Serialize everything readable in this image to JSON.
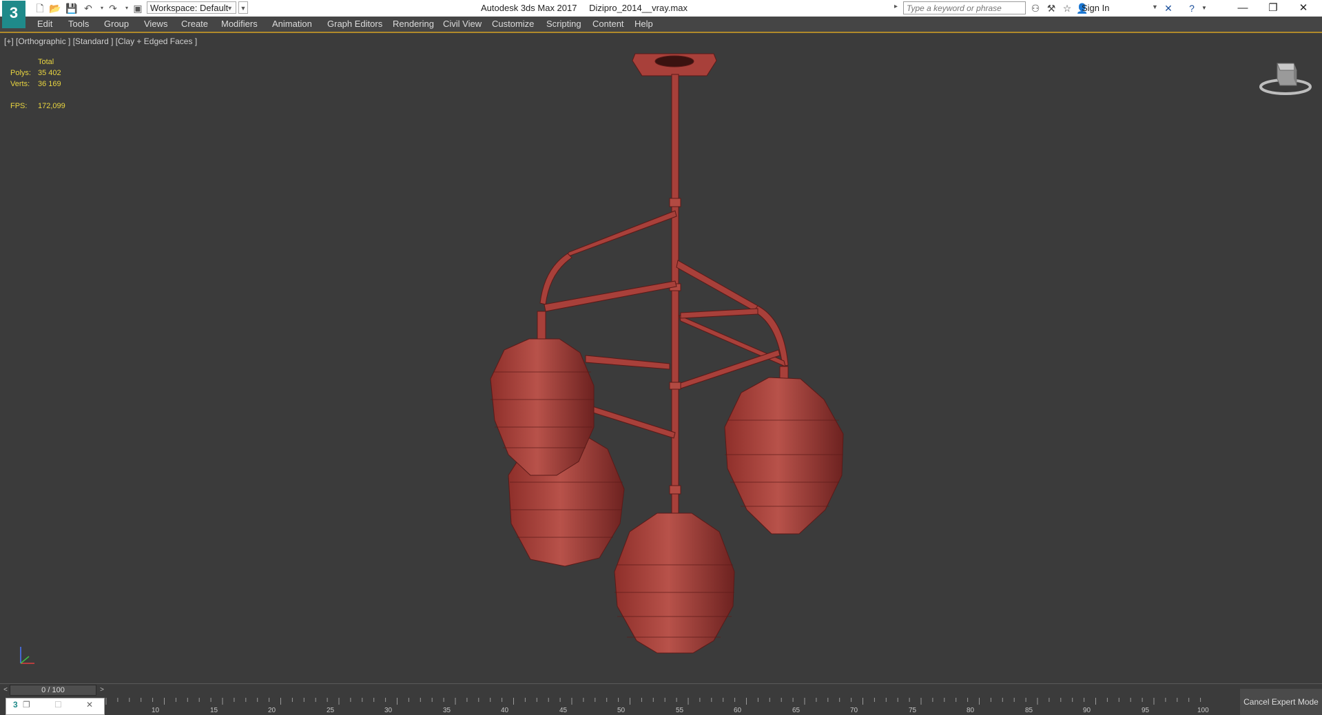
{
  "titlebar": {
    "logo_text": "3",
    "workspace_label": "Workspace: Default",
    "app_name": "Autodesk 3ds Max 2017",
    "file_name": "Dizipro_2014__vray.max",
    "search_placeholder": "Type a keyword or phrase",
    "sign_in_label": "Sign In"
  },
  "menu": {
    "items": [
      "Edit",
      "Tools",
      "Group",
      "Views",
      "Create",
      "Modifiers",
      "Animation",
      "Graph Editors",
      "Rendering",
      "Civil View",
      "Customize",
      "Scripting",
      "Content",
      "Help"
    ]
  },
  "viewport": {
    "label": "[+] [Orthographic ] [Standard ] [Clay + Edged Faces ]",
    "stats": {
      "header": "Total",
      "polys_label": "Polys:",
      "polys_value": "35 402",
      "verts_label": "Verts:",
      "verts_value": "36 169",
      "fps_label": "FPS:",
      "fps_value": "172,099"
    },
    "model_color": "#a8403a"
  },
  "timeline": {
    "slider_label": "0 / 100",
    "ticks": [
      "10",
      "15",
      "20",
      "25",
      "30",
      "35",
      "40",
      "45",
      "50",
      "55",
      "60",
      "65",
      "70",
      "75",
      "80",
      "85",
      "90",
      "95",
      "100"
    ]
  },
  "status": {
    "expert_mode_label": "Cancel Expert Mode"
  },
  "colors": {
    "accent": "#b08a2a",
    "stats_yellow": "#e9d540",
    "viewport_bg": "#3b3b3b"
  }
}
